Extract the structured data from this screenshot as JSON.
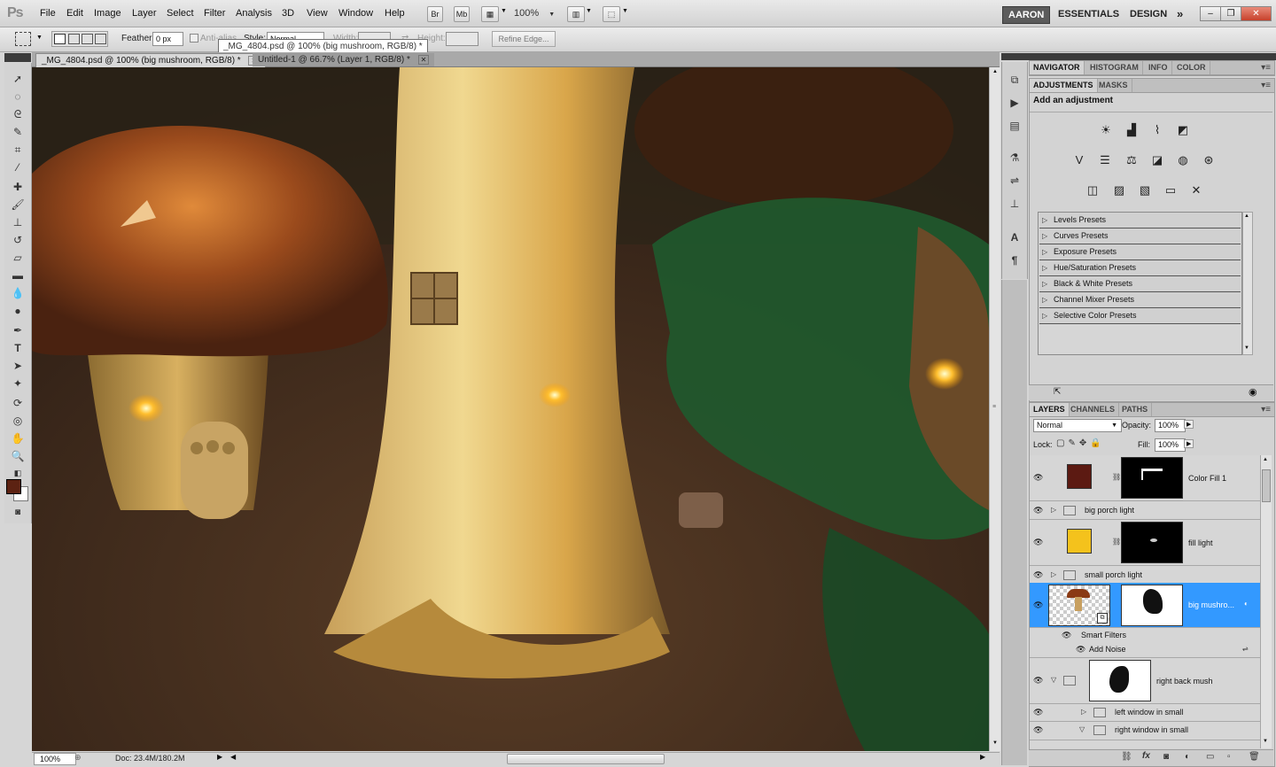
{
  "app": {
    "logo": "Ps"
  },
  "menu": [
    "File",
    "Edit",
    "Image",
    "Layer",
    "Select",
    "Filter",
    "Analysis",
    "3D",
    "View",
    "Window",
    "Help"
  ],
  "menubar_buttons": {
    "bridge": "Br",
    "mini_bridge": "Mb",
    "zoom": "100%"
  },
  "workspaces": {
    "active": "AARON",
    "essentials": "ESSENTIALS",
    "design": "DESIGN",
    "more": "»"
  },
  "window_controls": {
    "minimize": "–",
    "restore": "❐",
    "close": "✕"
  },
  "options": {
    "feather_label": "Feather:",
    "feather_value": "0 px",
    "antialias_label": "Anti-alias",
    "style_label": "Style:",
    "style_value": "Normal",
    "width_label": "Width:",
    "height_label": "Height:",
    "refine_edge": "Refine Edge..."
  },
  "tooltip": "_MG_4804.psd @ 100% (big mushroom, RGB/8) *",
  "documents": [
    {
      "title": "_MG_4804.psd @ 100% (big mushroom, RGB/8) *",
      "active": true
    },
    {
      "title": "Untitled-1 @ 66.7% (Layer 1, RGB/8) *",
      "active": false
    }
  ],
  "status": {
    "zoom": "100%",
    "doc": "Doc: 23.4M/180.2M"
  },
  "colors": {
    "foreground": "#5c2212",
    "background": "#ffffff",
    "selection": "#3399ff"
  },
  "panels": {
    "top_tabs": [
      "NAVIGATOR",
      "HISTOGRAM",
      "INFO",
      "COLOR"
    ],
    "adj_tabs": [
      "ADJUSTMENTS",
      "MASKS"
    ],
    "add_adjustment": "Add an adjustment",
    "presets": [
      "Levels Presets",
      "Curves Presets",
      "Exposure Presets",
      "Hue/Saturation Presets",
      "Black & White Presets",
      "Channel Mixer Presets",
      "Selective Color Presets"
    ],
    "layer_tabs": [
      "LAYERS",
      "CHANNELS",
      "PATHS"
    ]
  },
  "layers": {
    "blend_mode": "Normal",
    "opacity_label": "Opacity:",
    "opacity": "100%",
    "lock_label": "Lock:",
    "fill_label": "Fill:",
    "fill": "100%",
    "items": [
      {
        "name": "Color Fill 1"
      },
      {
        "name": "big porch light"
      },
      {
        "name": "fill light"
      },
      {
        "name": "small porch light"
      },
      {
        "name": "big mushro..."
      },
      {
        "name": "Smart Filters"
      },
      {
        "name": "Add Noise"
      },
      {
        "name": "right back mush"
      },
      {
        "name": "left window in small"
      },
      {
        "name": "right window in small"
      }
    ]
  }
}
